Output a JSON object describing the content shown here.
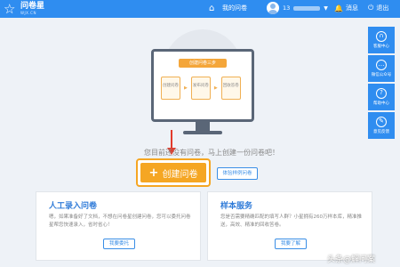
{
  "header": {
    "logo_name": "问卷星",
    "logo_sub": "WJX.CN",
    "home_label": "我的问卷",
    "user_id": "13",
    "messages_label": "消息",
    "logout_label": "退出"
  },
  "illustration": {
    "screen_title": "创建问卷三步",
    "steps": [
      "创建问卷",
      "发布问卷",
      "回收答卷"
    ]
  },
  "main": {
    "empty_text": "您目前还没有问卷，马上创建一份问卷吧！",
    "create_label": "创建问卷",
    "sample_label": "体验样例问卷"
  },
  "cards": [
    {
      "title": "人工录入问卷",
      "desc": "嗯，如果准备好了文档，不想在问卷星创建问卷，您可以委托问卷星帮您快速录入，省时省心！",
      "button": "我要委托"
    },
    {
      "title": "样本服务",
      "desc": "您是否需要精确匹配的填写人群？小星拥有260万样本库，精准推送，高效、精准的回收答卷。",
      "button": "我要了解"
    }
  ],
  "sidebar": {
    "items": [
      {
        "label": "客服中心",
        "icon": "headset-icon"
      },
      {
        "label": "微信公众号",
        "icon": "wechat-icon"
      },
      {
        "label": "帮助中心",
        "icon": "question-icon"
      },
      {
        "label": "意见反馈",
        "icon": "feedback-icon"
      }
    ]
  },
  "watermark": "头条@解问案",
  "colors": {
    "brand_blue": "#2f8df0",
    "accent_orange": "#f5a623",
    "arrow_red": "#e23b2b"
  }
}
